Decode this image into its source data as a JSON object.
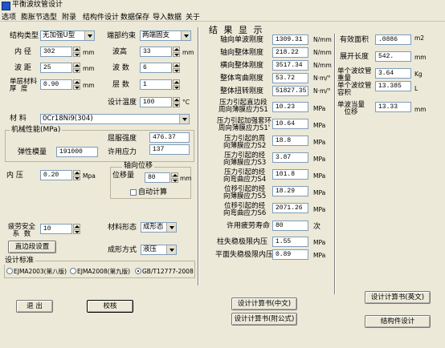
{
  "window": {
    "title": "平衡波纹管设计"
  },
  "menu": [
    "选项",
    "膨胀节选型",
    "附录",
    "结构件设计",
    "数据保存",
    "导入数据",
    "关于"
  ],
  "left": {
    "struct_type_label": "结构类型",
    "struct_type_value": "无加强U型",
    "end_constraint_label": "端部约束",
    "end_constraint_value": "两端固支",
    "inner_diam_label": "内 径",
    "inner_diam_value": "302",
    "inner_diam_unit": "mm",
    "wave_height_label": "波高",
    "wave_height_value": "33",
    "wave_height_unit": "mm",
    "wave_pitch_label": "波 距",
    "wave_pitch_value": "25",
    "wave_pitch_unit": "mm",
    "wave_count_label": "波 数",
    "wave_count_value": "6",
    "single_thickness_label": "单层材料\n厚  度",
    "single_thickness_value": "0.90",
    "single_thickness_unit": "mm",
    "layers_label": "层 数",
    "layers_value": "1",
    "design_temp_label": "设计温度",
    "design_temp_value": "100",
    "design_temp_unit": "°C",
    "material_label": "材 料",
    "material_value": "0Cr18Ni9(304)",
    "mech_group_label": "机械性能(MPa)",
    "yield_label": "屈服强度",
    "yield_value": "476.37",
    "elastic_label": "弹性模量",
    "elastic_value": "191000",
    "allow_label": "许用应力",
    "allow_value": "137",
    "pressure_label": "内 压",
    "pressure_value": "0.20",
    "pressure_unit": "Mpa",
    "disp_group_label": "轴向位移",
    "disp_label": "位移量",
    "disp_value": "80",
    "disp_unit": "mm",
    "auto_calc_label": "自动计算",
    "fatigue_label": "疲劳安全\n系  数",
    "fatigue_value": "10",
    "material_form_label": "材料形态",
    "material_form_value": "成形态",
    "forming_label": "成形方式",
    "forming_value": "液压",
    "direct_check_btn": "直边段设置",
    "standard_group_label": "设计标准",
    "standards": [
      "EJMA2003(第八版)",
      "EJMA2008(第九版)",
      "GB/T12777-2008"
    ],
    "exit_btn": "退 出",
    "check_btn": "校核"
  },
  "results": {
    "title": "结 果 显 示",
    "rows": [
      {
        "label": "轴向单波刚度",
        "value": "1309.31",
        "unit": "N/mm"
      },
      {
        "label": "轴向整体刚度",
        "value": "218.22",
        "unit": "N/mm"
      },
      {
        "label": "横向整体刚度",
        "value": "3517.34",
        "unit": "N/mm"
      },
      {
        "label": "整体弯曲刚度",
        "value": "53.72",
        "unit": "N·m/°"
      },
      {
        "label": "整体扭转刚度",
        "value": "51827.35",
        "unit": "N·m/°"
      }
    ],
    "stress_rows": [
      {
        "label": "压力引起直边段\n周向薄膜应力S1",
        "value": "10.23",
        "unit": "MPa"
      },
      {
        "label": "压力引起加强套环\n周向薄膜应力S1'",
        "value": "10.64",
        "unit": "MPa"
      },
      {
        "label": "压力引起的周\n向薄膜应力S2",
        "value": "18.8",
        "unit": "MPa"
      },
      {
        "label": "压力引起的经\n向薄膜应力S3",
        "value": "3.87",
        "unit": "MPa"
      },
      {
        "label": "压力引起的经\n向弯曲应力S4",
        "value": "101.8",
        "unit": "MPa"
      },
      {
        "label": "位移引起的经\n向薄膜应力S5",
        "value": "18.29",
        "unit": "MPa"
      },
      {
        "label": "位移引起的经\n向弯曲应力S6",
        "value": "2071.26",
        "unit": "MPa"
      }
    ],
    "life_label": "许用疲劳寿命",
    "life_value": "80",
    "life_unit": "次",
    "column_buckle_label": "柱失稳极限内压",
    "column_buckle_value": "1.55",
    "column_buckle_unit": "MPa",
    "plane_buckle_label": "平面失稳极限内压",
    "plane_buckle_value": "0.89",
    "plane_buckle_unit": "MPa",
    "area_label": "有效面积",
    "area_value": ".0886",
    "area_unit": "m2",
    "unfold_label": "展开长度",
    "unfold_value": "542.",
    "unfold_unit": "mm",
    "weight_label": "单个波纹管\n重量",
    "weight_value": "3.64",
    "weight_unit": "Kg",
    "volume_label": "单个波纹管\n容积",
    "volume_value": "13.385",
    "volume_unit": "L",
    "equiv_disp_label": "单波当量\n位移",
    "equiv_disp_value": "13.33",
    "equiv_disp_unit": "mm",
    "calc_cn_btn": "设计计算书(中文)",
    "calc_en_btn": "设计计算书(英文)",
    "calc_formula_btn": "设计计算书(附公式)",
    "struct_btn": "结构件设计"
  }
}
